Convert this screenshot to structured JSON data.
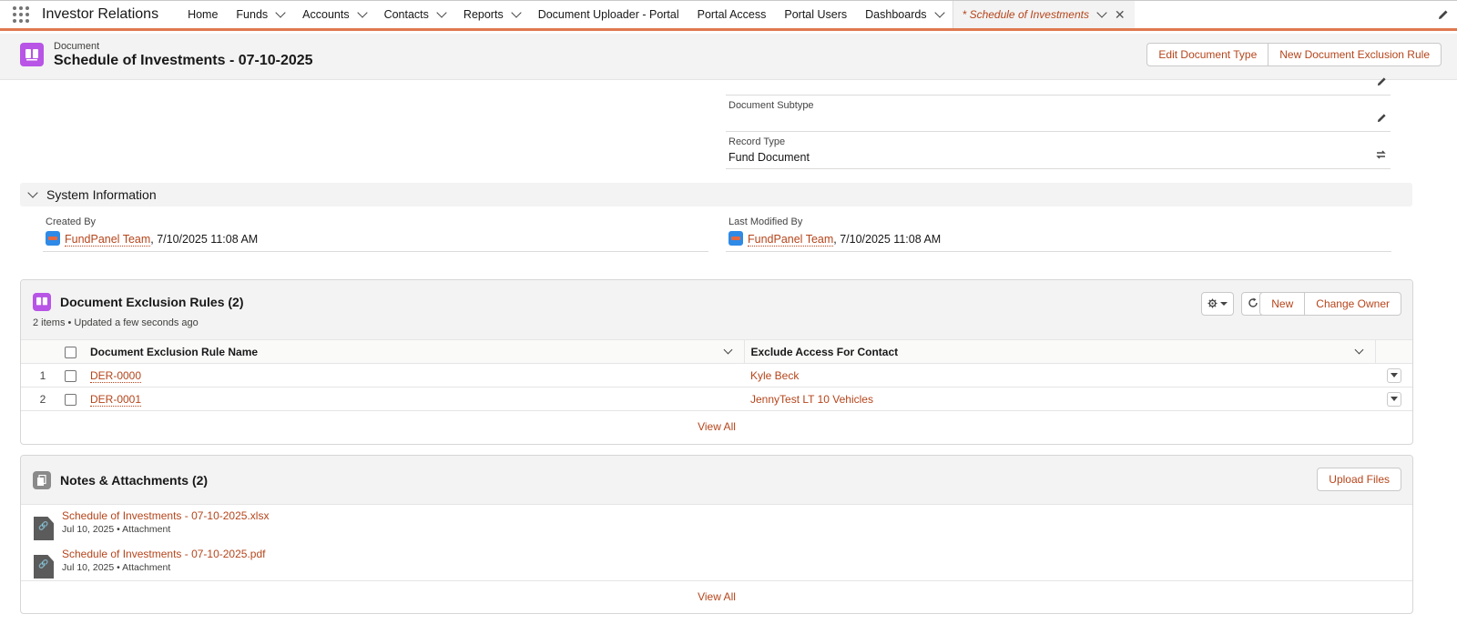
{
  "app": {
    "name": "Investor Relations"
  },
  "nav": {
    "items": [
      {
        "label": "Home",
        "dropdown": false
      },
      {
        "label": "Funds",
        "dropdown": true
      },
      {
        "label": "Accounts",
        "dropdown": true
      },
      {
        "label": "Contacts",
        "dropdown": true
      },
      {
        "label": "Reports",
        "dropdown": true
      },
      {
        "label": "Document Uploader - Portal",
        "dropdown": false
      },
      {
        "label": "Portal Access",
        "dropdown": false
      },
      {
        "label": "Portal Users",
        "dropdown": false
      },
      {
        "label": "Dashboards",
        "dropdown": true
      }
    ],
    "active_tab": "* Schedule of Investments - ..."
  },
  "record": {
    "object_label": "Document",
    "title": "Schedule of Investments - 07-10-2025",
    "actions": {
      "edit_type": "Edit Document Type",
      "new_rule": "New Document Exclusion Rule"
    }
  },
  "details": {
    "subtype_label": "Document Subtype",
    "subtype_value": "",
    "record_type_label": "Record Type",
    "record_type_value": "Fund Document"
  },
  "system_info": {
    "title": "System Information",
    "created_by_label": "Created By",
    "created_by_user": "FundPanel Team",
    "created_by_date": ", 7/10/2025 11:08 AM",
    "modified_by_label": "Last Modified By",
    "modified_by_user": "FundPanel Team",
    "modified_by_date": ", 7/10/2025 11:08 AM"
  },
  "exclusion_rules": {
    "title": "Document Exclusion Rules (2)",
    "subtitle": "2 items • Updated a few seconds ago",
    "new_label": "New",
    "change_owner_label": "Change Owner",
    "columns": [
      "Document Exclusion Rule Name",
      "Exclude Access For Contact"
    ],
    "rows": [
      {
        "num": "1",
        "name": "DER-0000",
        "contact": "Kyle Beck"
      },
      {
        "num": "2",
        "name": "DER-0001",
        "contact": "JennyTest LT 10 Vehicles"
      }
    ],
    "view_all": "View All"
  },
  "notes": {
    "title": "Notes & Attachments (2)",
    "upload_label": "Upload Files",
    "items": [
      {
        "name": "Schedule of Investments - 07-10-2025.xlsx",
        "meta": "Jul 10, 2025 • Attachment"
      },
      {
        "name": "Schedule of Investments - 07-10-2025.pdf",
        "meta": "Jul 10, 2025 • Attachment"
      }
    ],
    "view_all": "View All"
  },
  "colors": {
    "brand_orange": "#e0784f",
    "link": "#b5451b",
    "record_icon": "#b854e6"
  },
  "icons": [
    "app-launcher-icon",
    "chevron-down-icon",
    "close-icon",
    "pencil-icon",
    "document-icon",
    "swap-icon",
    "user-icon",
    "gear-icon",
    "refresh-icon",
    "attachment-icon"
  ]
}
